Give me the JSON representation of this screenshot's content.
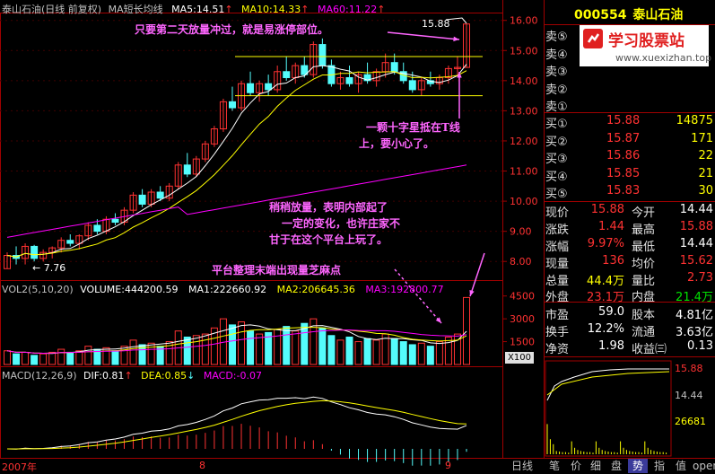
{
  "header": {
    "title": "泰山石油(日线 前复权)",
    "ma_title": "MA短长均线",
    "ma5": "MA5:14.51",
    "ma10": "MA10:14.33",
    "ma60": "MA60:11.22"
  },
  "vol_header": {
    "title": "VOL2(5,10,20)",
    "volume": "VOLUME:444200.59",
    "ma1": "MA1:222660.92",
    "ma2": "MA2:206645.36",
    "ma3": "MA3:192800.77"
  },
  "macd_header": {
    "title": "MACD(12,26,9)",
    "dif": "DIF:0.81",
    "dea": "DEA:0.85",
    "macd": "MACD:-0.07"
  },
  "price_labels": {
    "high_mark": "15.88",
    "low_mark": "7.76",
    "x100": "X100"
  },
  "x_axis": [
    "2007年",
    "8",
    "9"
  ],
  "y_axis_price": [
    "16.00",
    "15.00",
    "14.00",
    "13.00",
    "12.00",
    "11.00",
    "10.00",
    "9.00",
    "8.00"
  ],
  "y_axis_vol": [
    "4500",
    "3000",
    "1500"
  ],
  "annotations": {
    "a1": "只要第二天放量冲过，就是易涨停部位。",
    "a2_line1": "一颗十字星抵在T线",
    "a2_line2": "上，要小心了。",
    "a3_line1": "稍稍放量，表明内部起了",
    "a3_line2": "一定的变化，也许庄家不",
    "a3_line3": "甘于在这个平台上玩了。",
    "a4": "平台整理末端出现量芝麻点"
  },
  "stock": {
    "code": "000554",
    "name": "泰山石油",
    "watermark_title": "学习股票站",
    "watermark_url": "www.xuexizhan.top"
  },
  "sell_orders": [
    {
      "label": "卖⑤",
      "price": "",
      "vol": ""
    },
    {
      "label": "卖④",
      "price": "",
      "vol": ""
    },
    {
      "label": "卖③",
      "price": "",
      "vol": ""
    },
    {
      "label": "卖②",
      "price": "",
      "vol": ""
    },
    {
      "label": "卖①",
      "price": "",
      "vol": ""
    }
  ],
  "buy_orders": [
    {
      "label": "买①",
      "price": "15.88",
      "vol": "14875"
    },
    {
      "label": "买②",
      "price": "15.87",
      "vol": "171"
    },
    {
      "label": "买③",
      "price": "15.86",
      "vol": "22"
    },
    {
      "label": "买④",
      "price": "15.85",
      "vol": "21"
    },
    {
      "label": "买⑤",
      "price": "15.83",
      "vol": "30"
    }
  ],
  "stats": [
    {
      "l1": "现价",
      "v1": "15.88",
      "l2": "今开",
      "v2": "14.44"
    },
    {
      "l1": "涨跌",
      "v1": "1.44",
      "l2": "最高",
      "v2": "15.88"
    },
    {
      "l1": "涨幅",
      "v1": "9.97%",
      "l2": "最低",
      "v2": "14.44"
    },
    {
      "l1": "现量",
      "v1": "136",
      "l2": "均价",
      "v2": "15.62"
    },
    {
      "l1": "总量",
      "v1": "44.4万",
      "l2": "量比",
      "v2": "2.73"
    },
    {
      "l1": "外盘",
      "v1": "23.1万",
      "l2": "内盘",
      "v2": "21.4万"
    },
    {
      "l1": "市盈",
      "v1": "59.0",
      "l2": "股本",
      "v2": "4.81亿"
    },
    {
      "l1": "换手",
      "v1": "12.2%",
      "l2": "流通",
      "v2": "3.63亿"
    },
    {
      "l1": "净资",
      "v1": "1.98",
      "l2": "收益㈢",
      "v2": "0.13"
    }
  ],
  "mini_chart": {
    "top": "15.88",
    "mid": "14.44",
    "vol": "26681"
  },
  "tabs": [
    "日线",
    "笔",
    "价",
    "细",
    "盘",
    "势",
    "指",
    "值",
    "open"
  ],
  "colors": {
    "up": "#ff3232",
    "down": "#54fcfc",
    "ma5": "#ffffff",
    "ma10": "#ffff00",
    "ma60": "#ff00ff",
    "yellow": "#ffff00"
  },
  "chart_data": {
    "type": "candlestick",
    "price_range": [
      7.5,
      16.2
    ],
    "candles": [
      [
        7.76,
        8.3,
        7.76,
        8.2
      ],
      [
        8.2,
        8.5,
        7.9,
        8.1
      ],
      [
        8.1,
        8.6,
        7.9,
        8.5
      ],
      [
        8.5,
        8.55,
        8.0,
        8.1
      ],
      [
        8.1,
        8.4,
        8.0,
        8.3
      ],
      [
        8.3,
        8.5,
        8.1,
        8.45
      ],
      [
        8.45,
        8.8,
        8.3,
        8.7
      ],
      [
        8.7,
        8.9,
        8.5,
        8.6
      ],
      [
        8.6,
        8.9,
        8.4,
        8.85
      ],
      [
        8.85,
        9.3,
        8.7,
        9.2
      ],
      [
        9.2,
        9.4,
        8.9,
        9.0
      ],
      [
        9.0,
        9.5,
        8.9,
        9.4
      ],
      [
        9.4,
        9.6,
        9.2,
        9.3
      ],
      [
        9.3,
        9.8,
        9.2,
        9.7
      ],
      [
        9.7,
        10.3,
        9.6,
        10.2
      ],
      [
        10.2,
        10.4,
        9.8,
        9.9
      ],
      [
        9.9,
        10.4,
        9.8,
        10.3
      ],
      [
        10.3,
        10.5,
        10.0,
        10.1
      ],
      [
        10.1,
        10.6,
        10.0,
        10.5
      ],
      [
        10.5,
        11.3,
        10.4,
        11.2
      ],
      [
        11.2,
        11.6,
        10.8,
        10.9
      ],
      [
        10.9,
        11.5,
        10.8,
        11.4
      ],
      [
        11.4,
        12.0,
        11.3,
        11.9
      ],
      [
        11.9,
        12.5,
        11.8,
        12.4
      ],
      [
        12.4,
        13.4,
        12.3,
        13.3
      ],
      [
        13.3,
        13.8,
        13.0,
        13.1
      ],
      [
        13.1,
        14.0,
        13.0,
        13.9
      ],
      [
        13.9,
        14.3,
        13.5,
        13.6
      ],
      [
        13.6,
        14.0,
        13.3,
        13.9
      ],
      [
        13.9,
        14.2,
        13.5,
        13.7
      ],
      [
        13.7,
        14.5,
        13.6,
        14.3
      ],
      [
        14.3,
        14.8,
        14.0,
        14.1
      ],
      [
        14.1,
        14.6,
        13.9,
        14.5
      ],
      [
        14.5,
        14.8,
        14.1,
        14.2
      ],
      [
        14.2,
        15.3,
        14.1,
        15.2
      ],
      [
        15.2,
        15.4,
        14.4,
        14.5
      ],
      [
        14.5,
        14.7,
        13.8,
        13.9
      ],
      [
        13.9,
        14.3,
        13.7,
        14.1
      ],
      [
        14.1,
        14.5,
        13.8,
        13.9
      ],
      [
        13.9,
        14.3,
        13.6,
        14.2
      ],
      [
        14.2,
        14.6,
        13.9,
        14.0
      ],
      [
        14.0,
        14.4,
        13.8,
        14.3
      ],
      [
        14.3,
        14.9,
        14.1,
        14.6
      ],
      [
        14.6,
        14.9,
        14.2,
        14.3
      ],
      [
        14.3,
        14.6,
        13.9,
        14.0
      ],
      [
        14.0,
        14.3,
        13.6,
        13.7
      ],
      [
        13.7,
        14.1,
        13.5,
        14.0
      ],
      [
        14.0,
        14.3,
        13.8,
        13.9
      ],
      [
        13.9,
        14.2,
        13.7,
        14.1
      ],
      [
        14.1,
        14.5,
        13.9,
        14.4
      ],
      [
        14.4,
        14.8,
        14.2,
        14.44
      ],
      [
        14.44,
        15.88,
        14.44,
        15.88
      ]
    ],
    "volume": [
      9,
      7,
      8,
      6,
      7,
      8,
      10,
      8,
      9,
      12,
      10,
      11,
      9,
      12,
      16,
      13,
      14,
      12,
      15,
      22,
      18,
      19,
      20,
      24,
      30,
      26,
      28,
      22,
      20,
      21,
      23,
      25,
      22,
      27,
      30,
      24,
      19,
      16,
      18,
      15,
      17,
      16,
      20,
      17,
      15,
      13,
      14,
      12,
      15,
      18,
      20,
      44
    ],
    "vol_range": [
      0,
      46
    ]
  }
}
